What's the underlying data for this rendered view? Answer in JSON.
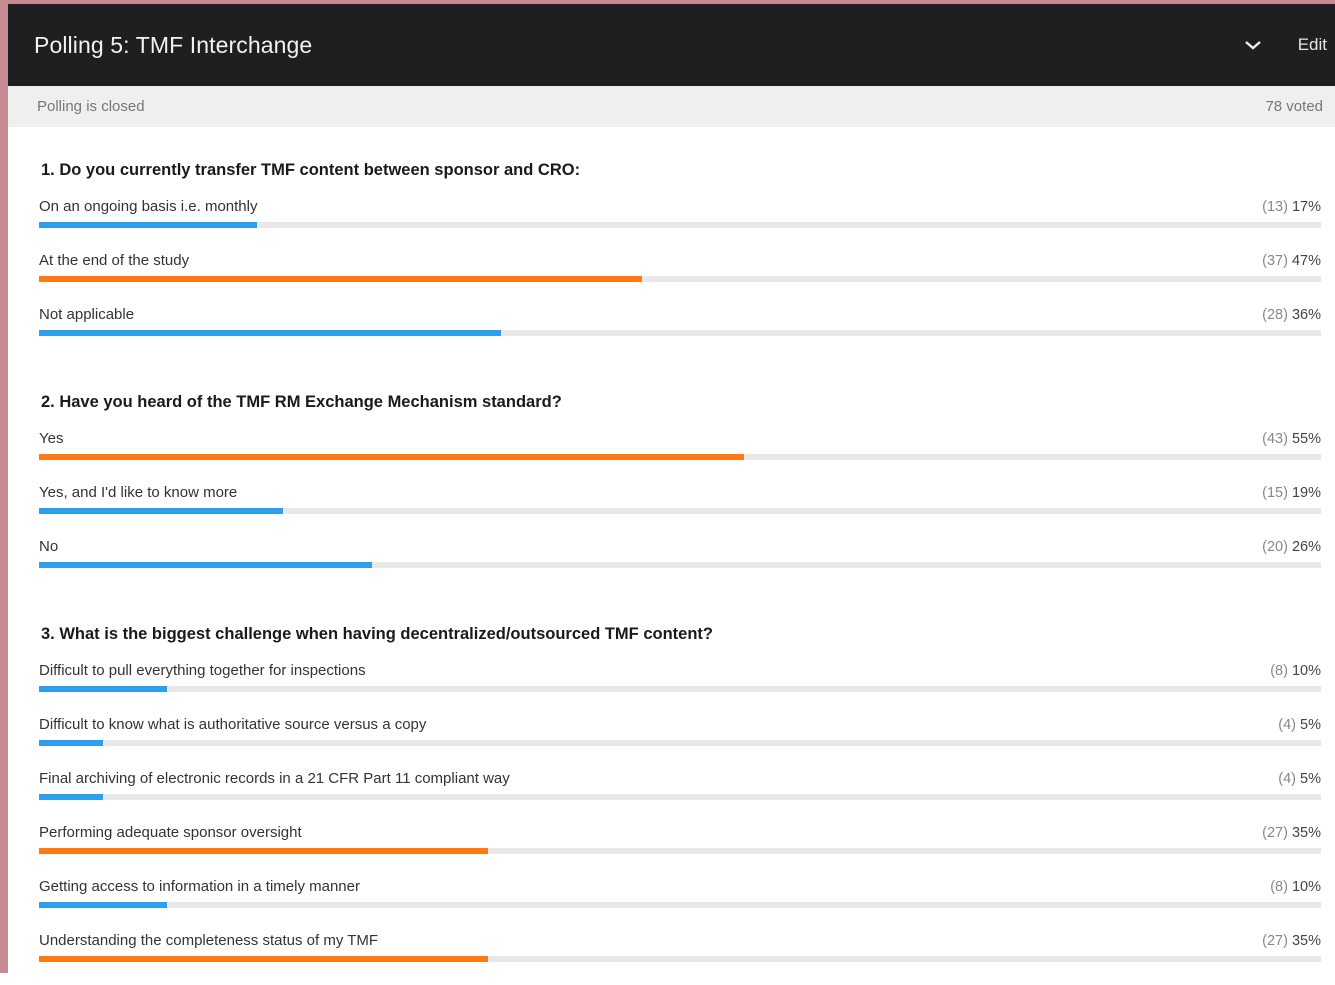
{
  "header": {
    "title": "Polling 5: TMF Interchange",
    "edit_label": "Edit"
  },
  "status": {
    "state": "Polling is closed",
    "voted": "78 voted"
  },
  "colors": {
    "blue": "#2d9fec",
    "orange": "#ff7a12"
  },
  "questions": [
    {
      "text": "1. Do you currently transfer TMF content between sponsor and CRO:",
      "options": [
        {
          "label": "On an ongoing basis i.e. monthly",
          "count": "(13)",
          "percent": "17%",
          "value": 17,
          "color": "blue"
        },
        {
          "label": "At the end of the study",
          "count": "(37)",
          "percent": "47%",
          "value": 47,
          "color": "orange"
        },
        {
          "label": "Not applicable",
          "count": "(28)",
          "percent": "36%",
          "value": 36,
          "color": "blue"
        }
      ]
    },
    {
      "text": "2. Have you heard of the TMF RM Exchange Mechanism standard?",
      "options": [
        {
          "label": "Yes",
          "count": "(43)",
          "percent": "55%",
          "value": 55,
          "color": "orange"
        },
        {
          "label": "Yes, and I'd like to know more",
          "count": "(15)",
          "percent": "19%",
          "value": 19,
          "color": "blue"
        },
        {
          "label": "No",
          "count": "(20)",
          "percent": "26%",
          "value": 26,
          "color": "blue"
        }
      ]
    },
    {
      "text": "3. What is the biggest challenge when having decentralized/outsourced TMF content?",
      "options": [
        {
          "label": "Difficult to pull everything together for inspections",
          "count": "(8)",
          "percent": "10%",
          "value": 10,
          "color": "blue"
        },
        {
          "label": "Difficult to know what is authoritative source versus a copy",
          "count": "(4)",
          "percent": "5%",
          "value": 5,
          "color": "blue"
        },
        {
          "label": "Final archiving of electronic records in a 21 CFR Part 11 compliant way",
          "count": "(4)",
          "percent": "5%",
          "value": 5,
          "color": "blue"
        },
        {
          "label": "Performing adequate sponsor oversight",
          "count": "(27)",
          "percent": "35%",
          "value": 35,
          "color": "orange"
        },
        {
          "label": "Getting access to information in a timely manner",
          "count": "(8)",
          "percent": "10%",
          "value": 10,
          "color": "blue"
        },
        {
          "label": "Understanding the completeness status of my TMF",
          "count": "(27)",
          "percent": "35%",
          "value": 35,
          "color": "orange"
        }
      ]
    }
  ]
}
